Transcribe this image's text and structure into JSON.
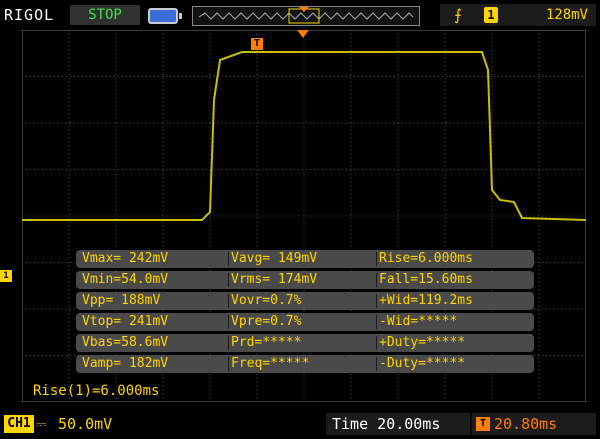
{
  "header": {
    "brand": "RIGOL",
    "run_state": "STOP",
    "trigger": {
      "edge_icon": "rising-edge-icon",
      "channel": "1",
      "level": "128mV"
    }
  },
  "markers": {
    "trigger_position": "T",
    "channel_marker": "1"
  },
  "measurements": [
    [
      "Vmax= 242mV",
      "Vavg= 149mV",
      "Rise=6.000ms"
    ],
    [
      "Vmin=54.0mV",
      "Vrms= 174mV",
      "Fall=15.60ms"
    ],
    [
      "Vpp= 188mV",
      "Vovr=0.7%",
      "+Wid=119.2ms"
    ],
    [
      "Vtop= 241mV",
      "Vpre=0.7%",
      "-Wid=*****"
    ],
    [
      "Vbas=58.6mV",
      "Prd=*****",
      "+Duty=*****"
    ],
    [
      "Vamp= 182mV",
      "Freq=*****",
      "-Duty=*****"
    ]
  ],
  "rise_readout": "Rise(1)=6.000ms",
  "footer": {
    "channel_label": "CH1",
    "coupling": "⎓",
    "scale": "50.0mV",
    "timebase": "Time 20.00ms",
    "offset_icon": "T",
    "offset": "20.80ms"
  },
  "colors": {
    "trace": "#c8c000",
    "accent_yellow": "#ffd400",
    "accent_orange": "#ff7d00",
    "stop_green": "#3ee24a"
  }
}
